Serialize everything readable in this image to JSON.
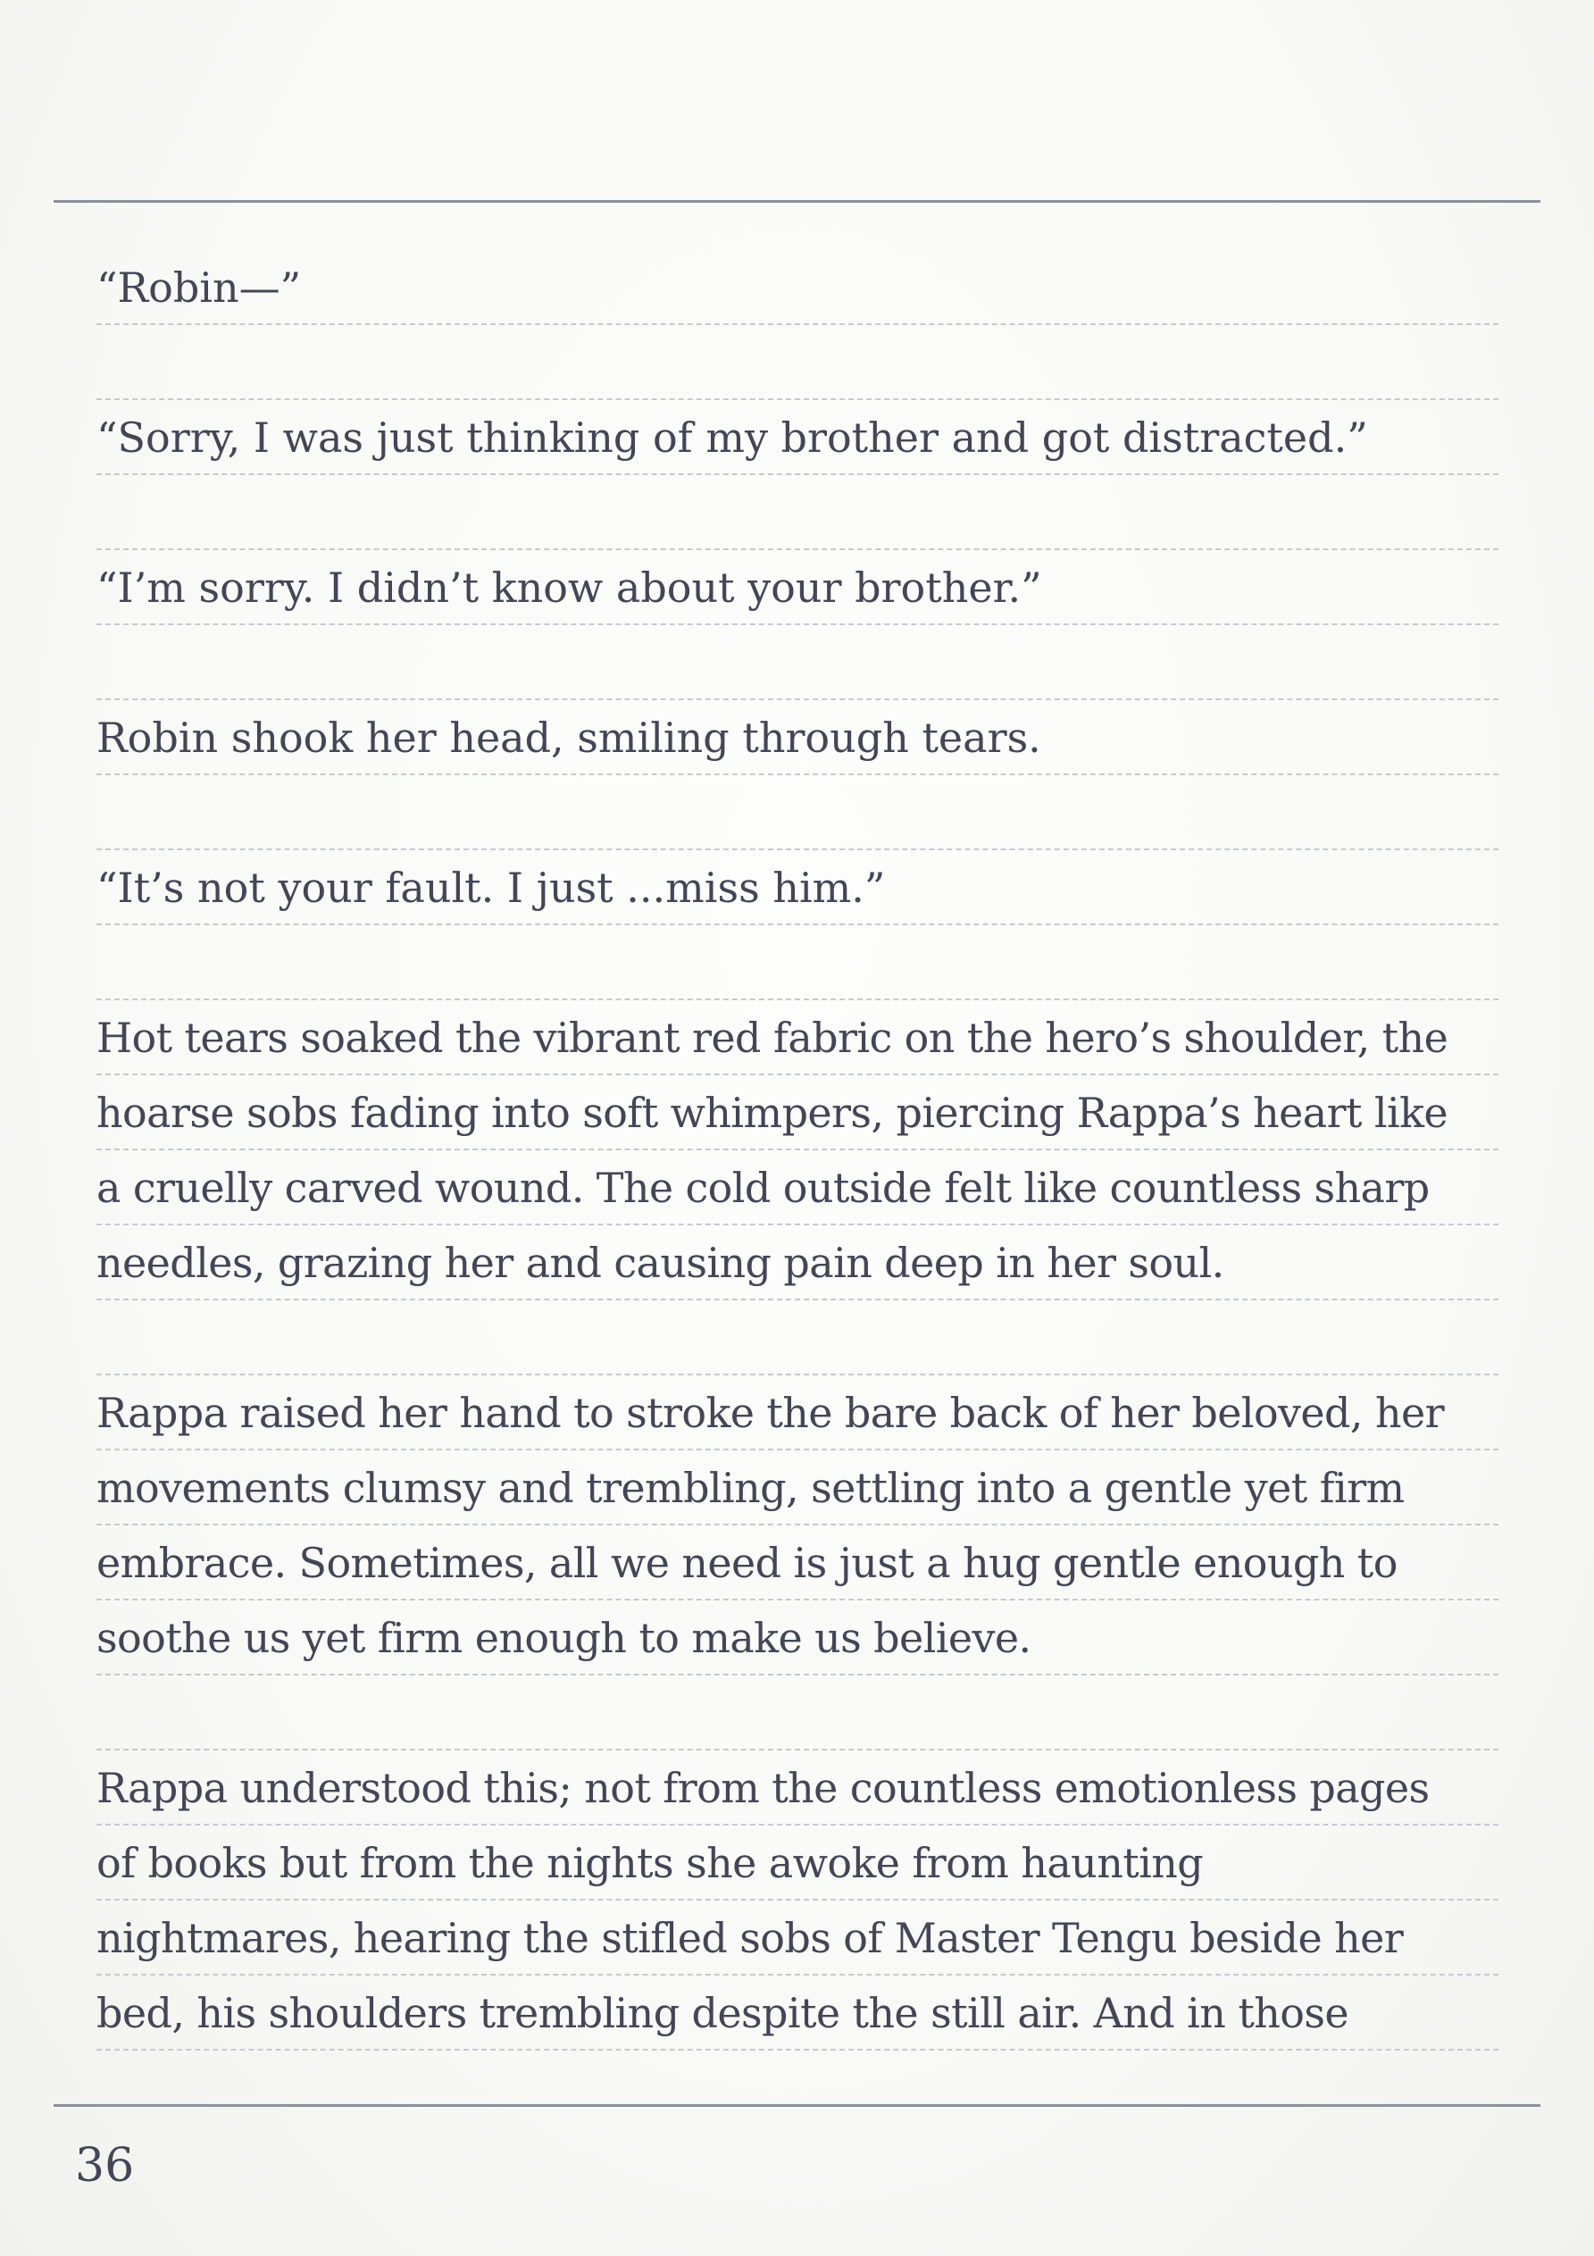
{
  "lines": [
    "“Robin—”",
    "",
    "“Sorry, I was just thinking of my brother and got distracted.”",
    "",
    "“I’m sorry. I didn’t know about your brother.”",
    "",
    "Robin shook her head, smiling through tears.",
    "",
    "“It’s not your fault. I just ...miss him.”",
    "",
    "Hot tears soaked the vibrant red fabric on the hero’s shoulder, the",
    "hoarse sobs fading into soft whimpers, piercing Rappa’s heart like",
    "a cruelly carved wound. The cold outside felt like countless sharp",
    "needles, grazing her and causing pain deep in her soul.",
    "",
    "Rappa raised her hand to stroke the bare back of her beloved, her",
    "movements clumsy and trembling, settling into a gentle yet firm",
    "embrace. Sometimes, all we need is just a hug gentle enough to",
    "soothe us yet firm enough to make us believe.",
    "",
    "Rappa understood this; not from the countless emotionless pages",
    "of books but from the nights she awoke from haunting",
    "nightmares, hearing the stifled sobs of Master Tengu beside her",
    "bed, his shoulders trembling despite the still air. And in those"
  ],
  "page_number": "36"
}
